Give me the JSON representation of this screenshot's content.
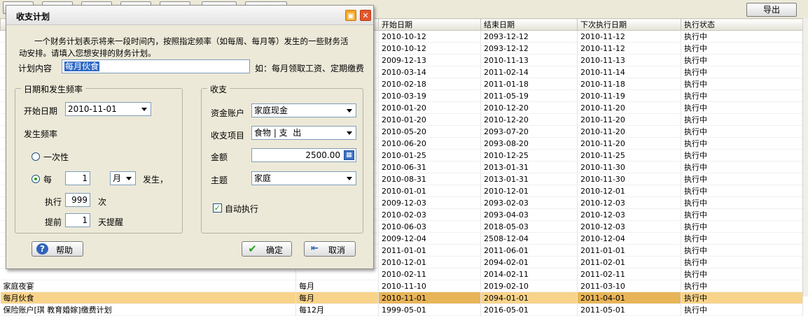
{
  "toolbar": {
    "export_label": "导出"
  },
  "grid": {
    "columns": [
      "开始日期",
      "结束日期",
      "下次执行日期",
      "执行状态"
    ],
    "rows": [
      {
        "name": "",
        "freq": "",
        "start": "2010-10-12",
        "end": "2093-12-12",
        "next": "2010-11-12",
        "status": "执行中"
      },
      {
        "name": "",
        "freq": "",
        "start": "2010-10-12",
        "end": "2093-12-12",
        "next": "2010-11-12",
        "status": "执行中"
      },
      {
        "name": "",
        "freq": "",
        "start": "2009-12-13",
        "end": "2010-11-13",
        "next": "2010-11-13",
        "status": "执行中"
      },
      {
        "name": "",
        "freq": "",
        "start": "2010-03-14",
        "end": "2011-02-14",
        "next": "2010-11-14",
        "status": "执行中"
      },
      {
        "name": "",
        "freq": "",
        "start": "2010-02-18",
        "end": "2011-01-18",
        "next": "2010-11-18",
        "status": "执行中"
      },
      {
        "name": "",
        "freq": "",
        "start": "2010-03-19",
        "end": "2011-05-19",
        "next": "2010-11-19",
        "status": "执行中"
      },
      {
        "name": "",
        "freq": "",
        "start": "2010-01-20",
        "end": "2010-12-20",
        "next": "2010-11-20",
        "status": "执行中"
      },
      {
        "name": "",
        "freq": "",
        "start": "2010-01-20",
        "end": "2010-12-20",
        "next": "2010-11-20",
        "status": "执行中"
      },
      {
        "name": "",
        "freq": "",
        "start": "2010-05-20",
        "end": "2093-07-20",
        "next": "2010-11-20",
        "status": "执行中"
      },
      {
        "name": "",
        "freq": "",
        "start": "2010-06-20",
        "end": "2093-08-20",
        "next": "2010-11-20",
        "status": "执行中"
      },
      {
        "name": "",
        "freq": "",
        "start": "2010-01-25",
        "end": "2010-12-25",
        "next": "2010-11-25",
        "status": "执行中"
      },
      {
        "name": "",
        "freq": "",
        "start": "2010-06-31",
        "end": "2013-01-31",
        "next": "2010-11-30",
        "status": "执行中"
      },
      {
        "name": "",
        "freq": "",
        "start": "2010-08-31",
        "end": "2013-01-31",
        "next": "2010-11-30",
        "status": "执行中"
      },
      {
        "name": "",
        "freq": "",
        "start": "2010-01-01",
        "end": "2010-12-01",
        "next": "2010-12-01",
        "status": "执行中"
      },
      {
        "name": "",
        "freq": "",
        "start": "2009-12-03",
        "end": "2093-02-03",
        "next": "2010-12-03",
        "status": "执行中"
      },
      {
        "name": "",
        "freq": "",
        "start": "2010-02-03",
        "end": "2093-04-03",
        "next": "2010-12-03",
        "status": "执行中"
      },
      {
        "name": "",
        "freq": "",
        "start": "2010-06-03",
        "end": "2018-05-03",
        "next": "2010-12-03",
        "status": "执行中"
      },
      {
        "name": "",
        "freq": "",
        "start": "2009-12-04",
        "end": "2508-12-04",
        "next": "2010-12-04",
        "status": "执行中"
      },
      {
        "name": "",
        "freq": "",
        "start": "2011-01-01",
        "end": "2011-06-01",
        "next": "2011-01-01",
        "status": "执行中"
      },
      {
        "name": "",
        "freq": "",
        "start": "2010-12-01",
        "end": "2094-02-01",
        "next": "2011-02-01",
        "status": "执行中"
      },
      {
        "name": "",
        "freq": "",
        "start": "2010-02-11",
        "end": "2014-02-11",
        "next": "2011-02-11",
        "status": "执行中"
      },
      {
        "name": "家庭夜宴",
        "freq": "每月",
        "start": "2010-11-10",
        "end": "2019-02-10",
        "next": "2011-03-10",
        "status": "执行中"
      },
      {
        "name": "每月伙食",
        "freq": "每月",
        "start": "2010-11-01",
        "end": "2094-01-01",
        "next": "2011-04-01",
        "status": "执行中"
      },
      {
        "name": "保险账户[琪 教育婚嫁]缴费计划",
        "freq": "每12月",
        "start": "1999-05-01",
        "end": "2016-05-01",
        "next": "2011-05-01",
        "status": "执行中"
      }
    ],
    "selected_index": 22
  },
  "dialog": {
    "title": "收支计划",
    "description_line1": "一个财务计划表示将来一段时间内，按照指定频率（如每周、每月等）发生的一些财务活",
    "description_line2": "动安排。请填入您想安排的财务计划。",
    "plan_label": "计划内容",
    "plan_value": "每月伙食",
    "plan_hint": "如：每月领取工资、定期缴费",
    "date_group": {
      "title": "日期和发生频率",
      "start_label": "开始日期",
      "start_value": "2010-11-01",
      "freq_label": "发生频率",
      "once_label": "一次性",
      "every_label": "每",
      "every_value": "1",
      "unit_value": "月",
      "happen_label": "发生，",
      "exec_label": "执行",
      "exec_value": "999",
      "times_label": "次",
      "advance_label": "提前",
      "advance_value": "1",
      "remind_label": "天提醒",
      "selected_option": "every"
    },
    "money_group": {
      "title": "收支",
      "account_label": "资金账户",
      "account_value": "家庭现金",
      "item_label": "收支项目",
      "item_value": "食物 | 支  出",
      "amount_label": "金额",
      "amount_value": "2500.00",
      "subject_label": "主题",
      "subject_value": "家庭",
      "auto_label": "自动执行",
      "auto_checked": true
    },
    "help_label": "帮助",
    "ok_label": "确定",
    "cancel_label": "取消"
  },
  "colors": {
    "selected_row": "#f8d38a",
    "accent_green": "#21a121",
    "close_red": "#e2582c"
  }
}
